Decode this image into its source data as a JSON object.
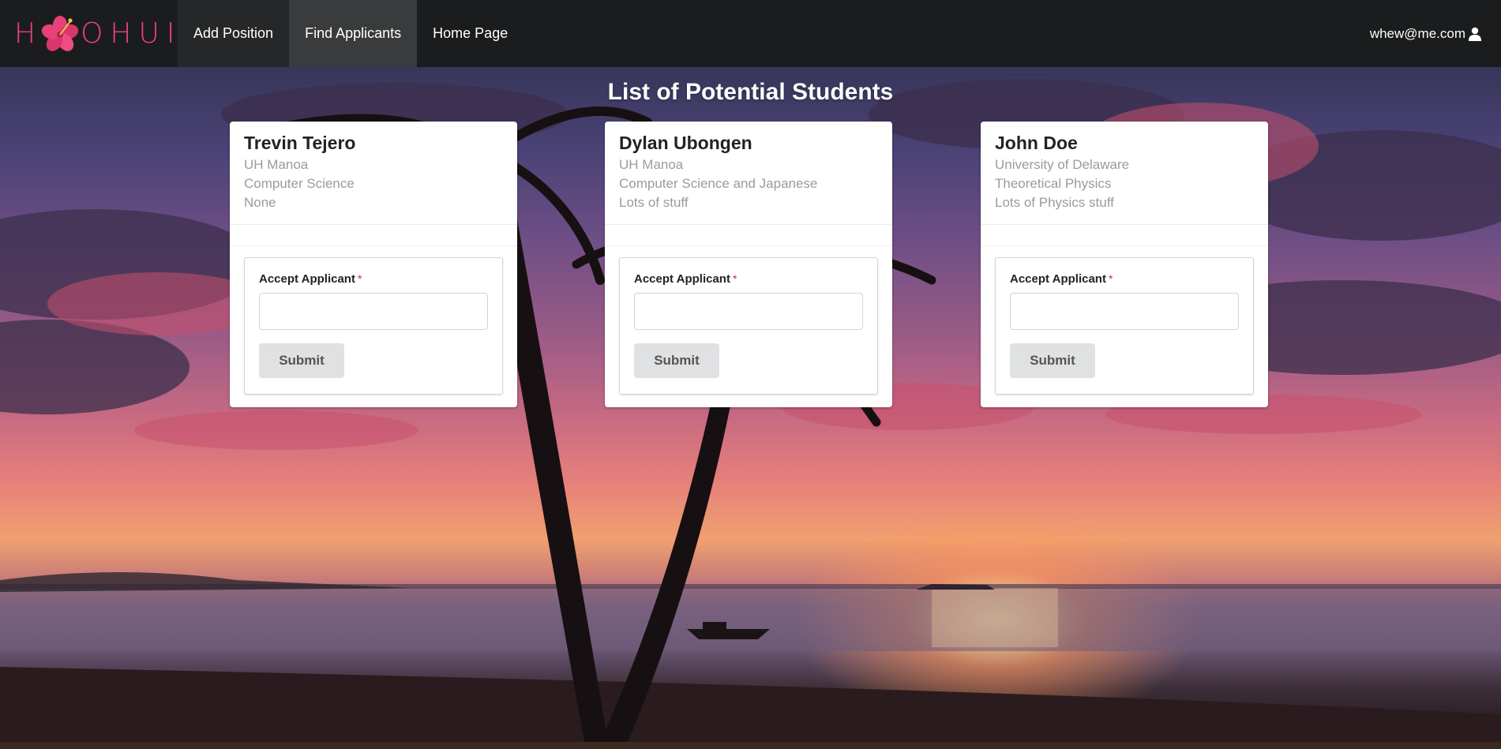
{
  "brand": {
    "logo_text": "HOOHUI",
    "accent": "#e8418c"
  },
  "nav": {
    "items": [
      {
        "label": "Add Position"
      },
      {
        "label": "Find Applicants"
      },
      {
        "label": "Home Page"
      }
    ],
    "user_email": "whew@me.com",
    "user_icon": "user-icon"
  },
  "page": {
    "title": "List of Potential Students"
  },
  "form": {
    "field_label": "Accept Applicant",
    "required_mark": "*",
    "input_value": "",
    "submit_label": "Submit"
  },
  "students": [
    {
      "name": "Trevin Tejero",
      "school": "UH Manoa",
      "major": "Computer Science",
      "details": "None"
    },
    {
      "name": "Dylan Ubongen",
      "school": "UH Manoa",
      "major": "Computer Science and Japanese",
      "details": "Lots of stuff"
    },
    {
      "name": "John Doe",
      "school": "University of Delaware",
      "major": "Theoretical Physics",
      "details": "Lots of Physics stuff"
    }
  ]
}
